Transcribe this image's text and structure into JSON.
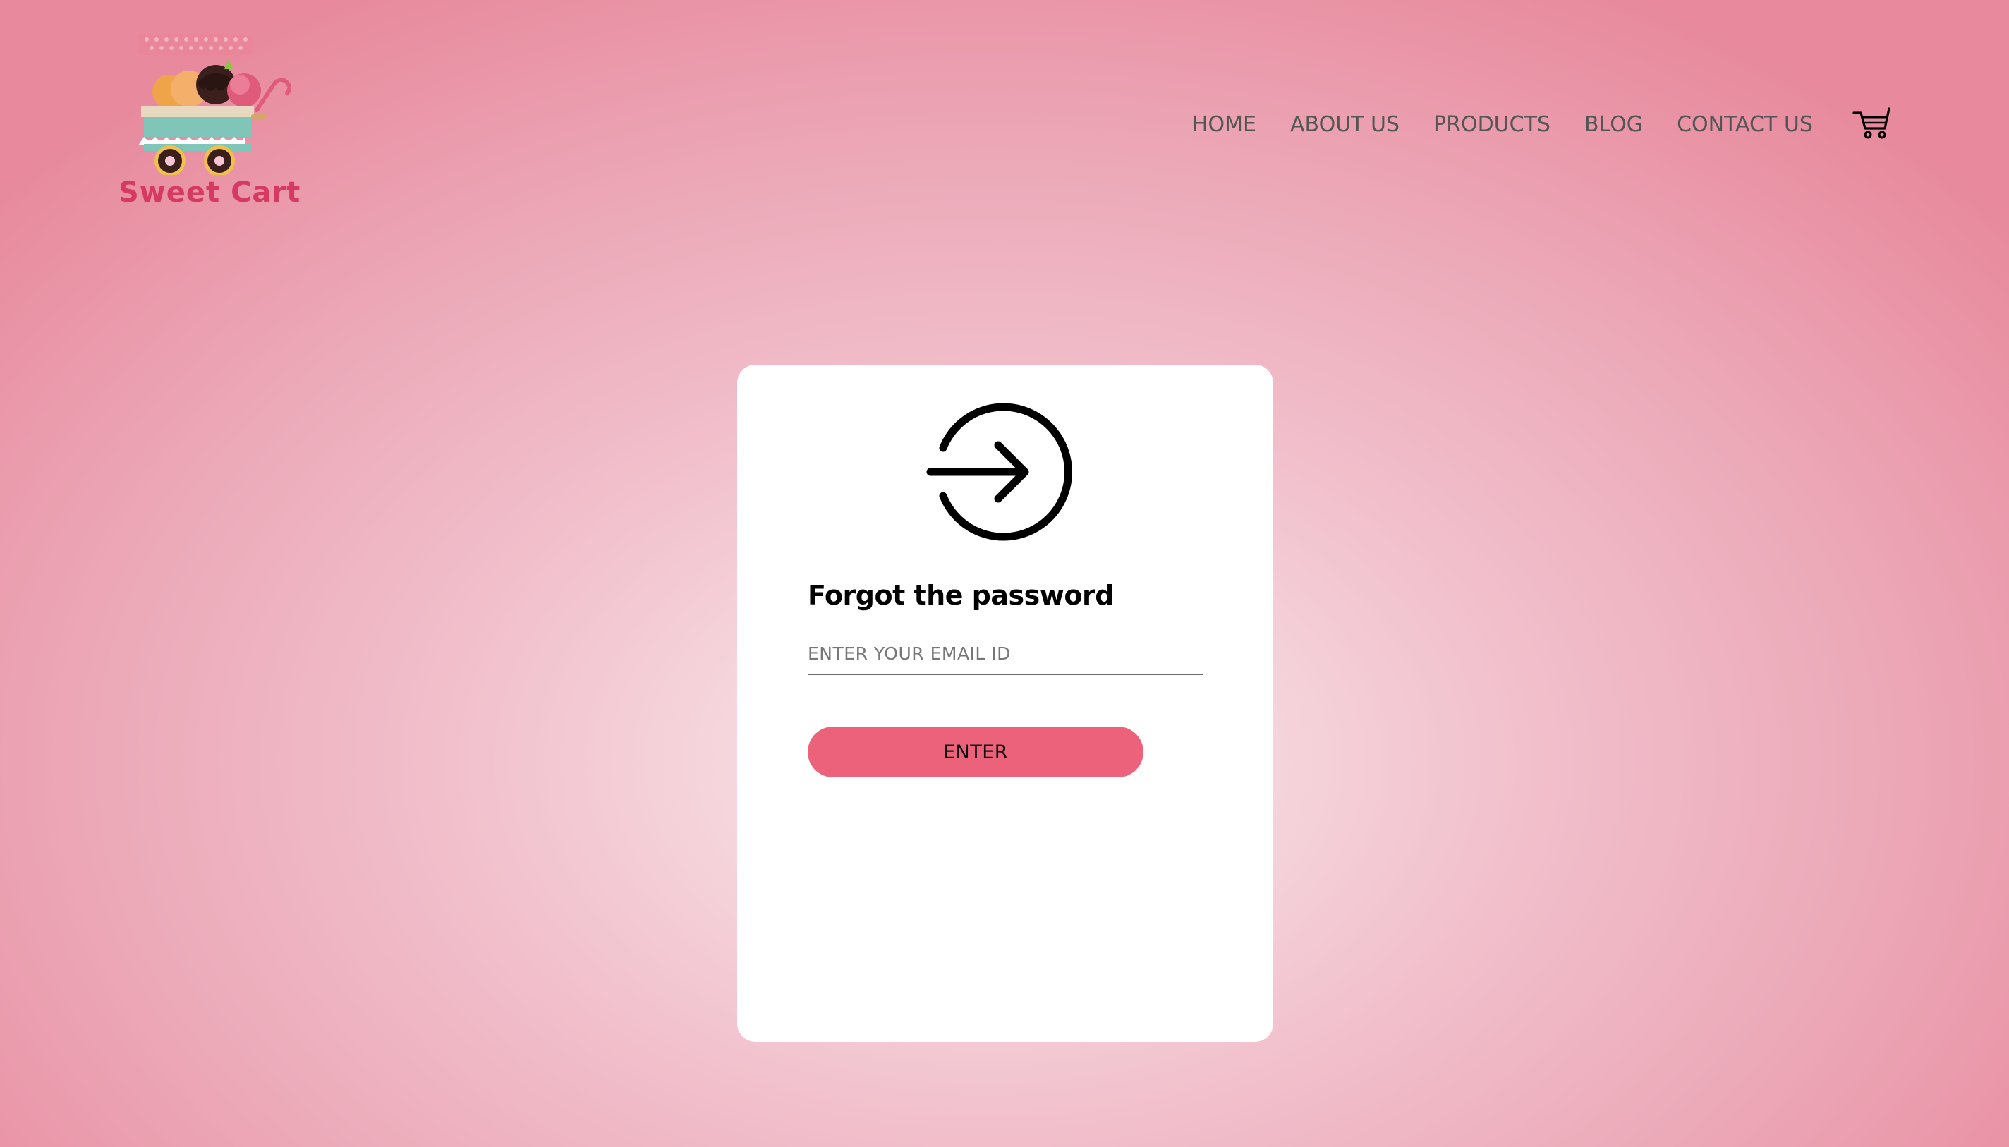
{
  "brand": {
    "name": "Sweet Cart",
    "accent_color": "#d43a62",
    "logo_icon": "ice-cream-cart-logo"
  },
  "nav": {
    "items": [
      {
        "label": "HOME"
      },
      {
        "label": "ABOUT US"
      },
      {
        "label": "PRODUCTS"
      },
      {
        "label": "BLOG"
      },
      {
        "label": "CONTACT US"
      }
    ],
    "cart_icon": "shopping-cart-icon"
  },
  "card": {
    "icon": "sign-in-arrow-icon",
    "title": "Forgot the password",
    "email_placeholder": "ENTER YOUR EMAIL ID",
    "email_value": "",
    "submit_label": "ENTER",
    "button_color": "#ec627b"
  }
}
